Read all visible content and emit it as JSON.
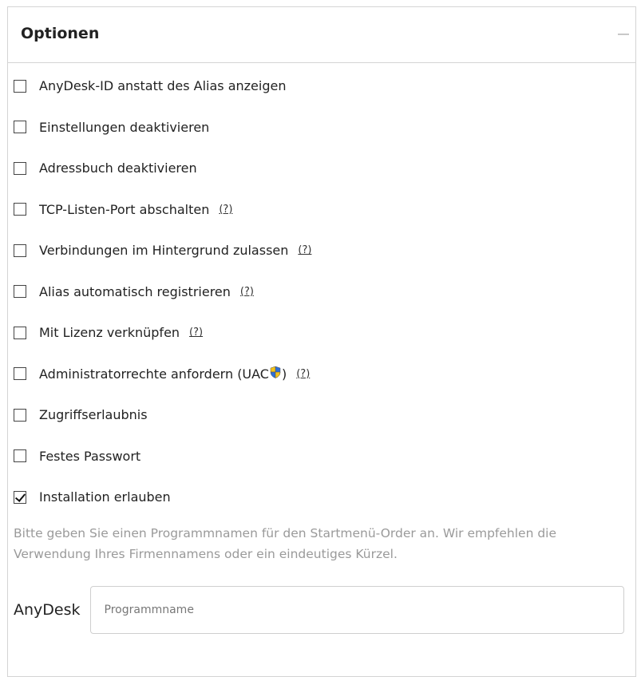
{
  "panel": {
    "title": "Optionen",
    "collapse_symbol": "–"
  },
  "options": [
    {
      "label": "AnyDesk-ID anstatt des Alias anzeigen",
      "checked": false,
      "help": ""
    },
    {
      "label": "Einstellungen deaktivieren",
      "checked": false,
      "help": ""
    },
    {
      "label": "Adressbuch deaktivieren",
      "checked": false,
      "help": ""
    },
    {
      "label": "TCP-Listen-Port abschalten",
      "checked": false,
      "help": "(?)"
    },
    {
      "label": "Verbindungen im Hintergrund zulassen",
      "checked": false,
      "help": "(?)"
    },
    {
      "label": "Alias automatisch registrieren",
      "checked": false,
      "help": "(?)"
    },
    {
      "label": "Mit Lizenz verknüpfen",
      "checked": false,
      "help": "(?)"
    },
    {
      "label": "Administratorrechte anfordern (UAC",
      "label_suffix": ")",
      "shield_icon": "uac-shield-icon",
      "checked": false,
      "help": "(?)"
    },
    {
      "label": "Zugriffserlaubnis",
      "checked": false,
      "help": ""
    },
    {
      "label": "Festes Passwort",
      "checked": false,
      "help": ""
    },
    {
      "label": "Installation erlauben",
      "checked": true,
      "help": ""
    }
  ],
  "hint": "Bitte geben Sie einen Programmnamen für den Startmenü-Order an. Wir empfehlen die Verwendung Ihres Firmennamens oder ein eindeutiges Kürzel.",
  "program_name": {
    "prefix": "AnyDesk",
    "value": "",
    "placeholder": "Programmname"
  },
  "colors": {
    "border": "#d4d4d4",
    "hint_text": "#9a9a9a",
    "shield_blue": "#2f6fd6",
    "shield_yellow": "#f2c21b"
  }
}
